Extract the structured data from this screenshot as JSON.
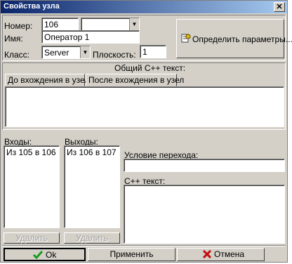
{
  "window": {
    "title": "Свойства узла",
    "close_glyph": "✕"
  },
  "header": {
    "number_label": "Номер:",
    "number_value": "106",
    "number_combo_value": "",
    "name_label": "Имя:",
    "name_value": "Оператор 1",
    "class_label": "Класс:",
    "class_value": "Server",
    "level_label": "Плоскость:",
    "level_value": "1",
    "define_params_label": "Определить параметры..."
  },
  "code": {
    "title": "Общий С++ текст:",
    "tabs": [
      {
        "label": "До вхождения в узел",
        "active": true
      },
      {
        "label": "После вхождения в узел",
        "active": false
      }
    ],
    "text": ""
  },
  "inputs": {
    "label": "Входы:",
    "items": [
      "Из 105 в 106"
    ],
    "delete_label": "Удалить"
  },
  "outputs": {
    "label": "Выходы:",
    "items": [
      "Из 106 в 107"
    ],
    "delete_label": "Удалить"
  },
  "transition": {
    "condition_label": "Условие перехода:",
    "condition_value": "",
    "code_label": "С++ текст:",
    "code_value": ""
  },
  "footer": {
    "ok_label": "Ok",
    "apply_label": "Применить",
    "cancel_label": "Отмена"
  },
  "colors": {
    "ok_check": "#1a9a1a",
    "cancel_x": "#c01010",
    "title_start": "#0a246a"
  }
}
